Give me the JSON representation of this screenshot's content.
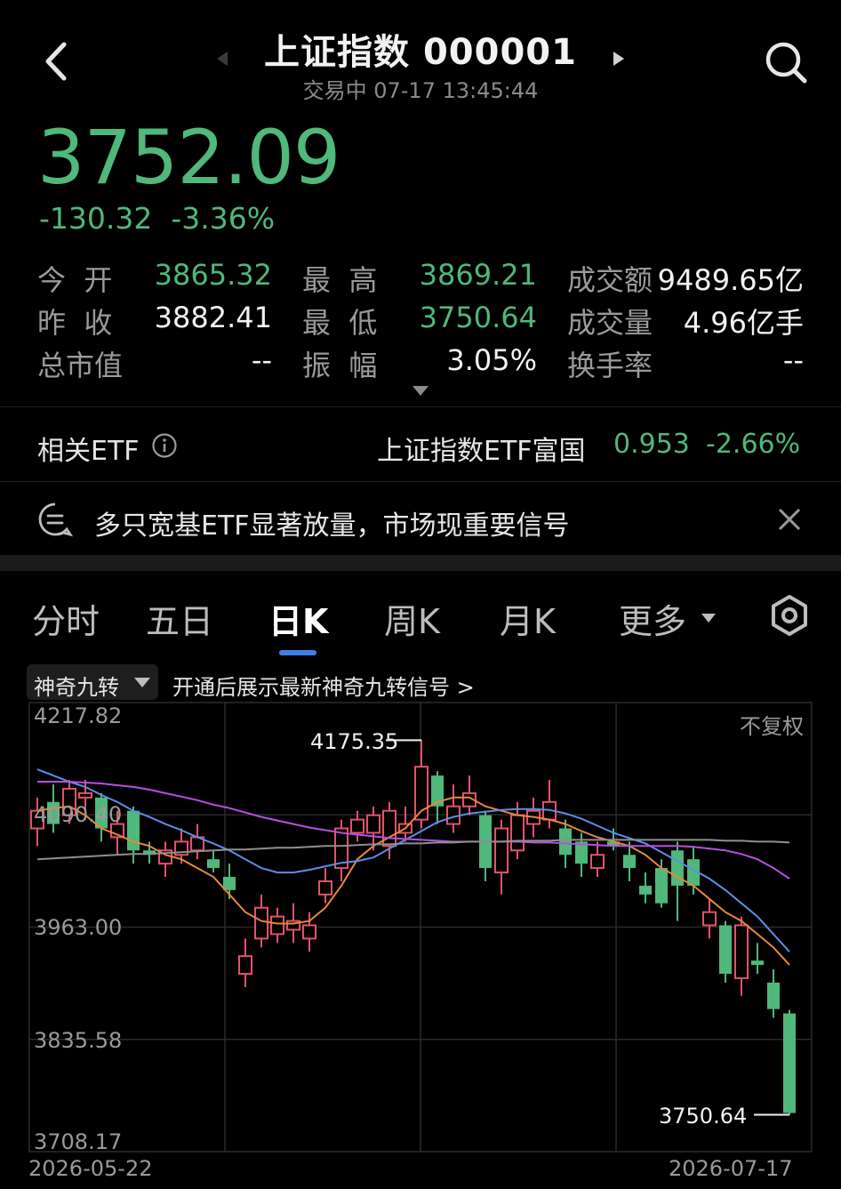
{
  "header": {
    "title": "上证指数 000001",
    "status": "交易中",
    "datetime": "07-17 13:45:44"
  },
  "quote": {
    "price": "3752.09",
    "change": "-130.32",
    "change_pct": "-3.36%"
  },
  "stats": [
    {
      "label": "今  开",
      "value": "3865.32",
      "color": "#4fb87a"
    },
    {
      "label": "最  高",
      "value": "3869.21",
      "color": "#4fb87a"
    },
    {
      "label": "成交额",
      "value": "9489.65亿",
      "color": "#f2f2f2"
    },
    {
      "label": "昨  收",
      "value": "3882.41",
      "color": "#f2f2f2"
    },
    {
      "label": "最  低",
      "value": "3750.64",
      "color": "#4fb87a"
    },
    {
      "label": "成交量",
      "value": "4.96亿手",
      "color": "#f2f2f2"
    },
    {
      "label": "总市值",
      "value": "--",
      "color": "#f2f2f2"
    },
    {
      "label": "振  幅",
      "value": "3.05%",
      "color": "#f2f2f2"
    },
    {
      "label": "换手率",
      "value": "--",
      "color": "#f2f2f2"
    }
  ],
  "etf": {
    "label": "相关ETF",
    "name": "上证指数ETF富国",
    "price": "0.953",
    "change_pct": "-2.66%"
  },
  "notice": {
    "text": "多只宽基ETF显著放量，市场现重要信号"
  },
  "tabs": [
    "分时",
    "五日",
    "日K",
    "周K",
    "月K",
    "更多"
  ],
  "active_tab": "日K",
  "indicator": {
    "chip_label": "神奇九转",
    "promo": "开通后展示最新神奇九转信号 >"
  },
  "chart_data": {
    "type": "candlestick",
    "adjust_label": "不复权",
    "y_ticks": [
      "4217.82",
      "4090.40",
      "3963.00",
      "3835.58",
      "3708.17"
    ],
    "ylim": [
      3708.17,
      4217.82
    ],
    "x_start": "2026-05-22",
    "x_end": "2026-07-17",
    "max_label": "4175.35",
    "min_label": "3750.64",
    "up_color": "#e0536a",
    "down_color": "#4fb87a",
    "candles": [
      {
        "o": 4075,
        "c": 4095,
        "h": 4110,
        "l": 4055
      },
      {
        "o": 4105,
        "c": 4080,
        "h": 4125,
        "l": 4070
      },
      {
        "o": 4090,
        "c": 4120,
        "h": 4130,
        "l": 4080
      },
      {
        "o": 4110,
        "c": 4115,
        "h": 4130,
        "l": 4085
      },
      {
        "o": 4110,
        "c": 4075,
        "h": 4115,
        "l": 4060
      },
      {
        "o": 4065,
        "c": 4080,
        "h": 4095,
        "l": 4045
      },
      {
        "o": 4095,
        "c": 4050,
        "h": 4100,
        "l": 4035
      },
      {
        "o": 4050,
        "c": 4045,
        "h": 4060,
        "l": 4035
      },
      {
        "o": 4035,
        "c": 4050,
        "h": 4060,
        "l": 4020
      },
      {
        "o": 4045,
        "c": 4060,
        "h": 4075,
        "l": 4035
      },
      {
        "o": 4050,
        "c": 4065,
        "h": 4080,
        "l": 4040
      },
      {
        "o": 4040,
        "c": 4030,
        "h": 4050,
        "l": 4025
      },
      {
        "o": 4020,
        "c": 4005,
        "h": 4035,
        "l": 3995
      },
      {
        "o": 3910,
        "c": 3930,
        "h": 3950,
        "l": 3895
      },
      {
        "o": 3950,
        "c": 3985,
        "h": 4000,
        "l": 3940
      },
      {
        "o": 3955,
        "c": 3975,
        "h": 3985,
        "l": 3945
      },
      {
        "o": 3960,
        "c": 3970,
        "h": 3990,
        "l": 3945
      },
      {
        "o": 3950,
        "c": 3965,
        "h": 3980,
        "l": 3935
      },
      {
        "o": 4000,
        "c": 4015,
        "h": 4030,
        "l": 3990
      },
      {
        "o": 4030,
        "c": 4075,
        "h": 4085,
        "l": 4015
      },
      {
        "o": 4070,
        "c": 4085,
        "h": 4095,
        "l": 4060
      },
      {
        "o": 4070,
        "c": 4090,
        "h": 4100,
        "l": 4050
      },
      {
        "o": 4055,
        "c": 4095,
        "h": 4105,
        "l": 4040
      },
      {
        "o": 4070,
        "c": 4080,
        "h": 4100,
        "l": 4060
      },
      {
        "o": 4085,
        "c": 4145,
        "h": 4175,
        "l": 4075
      },
      {
        "o": 4135,
        "c": 4100,
        "h": 4140,
        "l": 4080
      },
      {
        "o": 4080,
        "c": 4100,
        "h": 4125,
        "l": 4070
      },
      {
        "o": 4100,
        "c": 4115,
        "h": 4135,
        "l": 4090
      },
      {
        "o": 4090,
        "c": 4030,
        "h": 4095,
        "l": 4015
      },
      {
        "o": 4025,
        "c": 4075,
        "h": 4085,
        "l": 4000
      },
      {
        "o": 4050,
        "c": 4090,
        "h": 4105,
        "l": 4040
      },
      {
        "o": 4080,
        "c": 4095,
        "h": 4110,
        "l": 4065
      },
      {
        "o": 4085,
        "c": 4105,
        "h": 4130,
        "l": 4075
      },
      {
        "o": 4075,
        "c": 4045,
        "h": 4085,
        "l": 4030
      },
      {
        "o": 4060,
        "c": 4035,
        "h": 4070,
        "l": 4020
      },
      {
        "o": 4030,
        "c": 4045,
        "h": 4060,
        "l": 4020
      },
      {
        "o": 4060,
        "c": 4055,
        "h": 4075,
        "l": 4050
      },
      {
        "o": 4045,
        "c": 4030,
        "h": 4060,
        "l": 4015
      },
      {
        "o": 4010,
        "c": 4000,
        "h": 4025,
        "l": 3990
      },
      {
        "o": 4030,
        "c": 3990,
        "h": 4040,
        "l": 3985
      },
      {
        "o": 4050,
        "c": 4010,
        "h": 4060,
        "l": 3970
      },
      {
        "o": 4040,
        "c": 4010,
        "h": 4055,
        "l": 4000
      },
      {
        "o": 3965,
        "c": 3980,
        "h": 3995,
        "l": 3950
      },
      {
        "o": 3965,
        "c": 3910,
        "h": 3970,
        "l": 3900
      },
      {
        "o": 3905,
        "c": 3965,
        "h": 3975,
        "l": 3885
      },
      {
        "o": 3925,
        "c": 3920,
        "h": 3945,
        "l": 3910
      },
      {
        "o": 3900,
        "c": 3870,
        "h": 3915,
        "l": 3860
      },
      {
        "o": 3865,
        "c": 3752,
        "h": 3869,
        "l": 3750
      }
    ],
    "series": [
      {
        "name": "",
        "color": "#e8873c",
        "values": [
          4095,
          4098,
          4100,
          4090,
          4075,
          4068,
          4060,
          4055,
          4045,
          4040,
          4030,
          4020,
          4000,
          3980,
          3970,
          3967,
          3967,
          3970,
          3985,
          4010,
          4040,
          4055,
          4065,
          4075,
          4095,
          4105,
          4110,
          4110,
          4100,
          4095,
          4090,
          4088,
          4085,
          4080,
          4072,
          4065,
          4060,
          4055,
          4045,
          4030,
          4020,
          4010,
          3995,
          3980,
          3970,
          3955,
          3940,
          3920
        ]
      },
      {
        "name": "",
        "color": "#5b8ee8",
        "values": [
          4142,
          4135,
          4128,
          4122,
          4113,
          4105,
          4095,
          4088,
          4080,
          4073,
          4065,
          4058,
          4050,
          4040,
          4030,
          4025,
          4025,
          4028,
          4032,
          4036,
          4038,
          4042,
          4052,
          4062,
          4072,
          4082,
          4088,
          4092,
          4094,
          4096,
          4097,
          4097,
          4096,
          4092,
          4086,
          4078,
          4070,
          4064,
          4058,
          4048,
          4038,
          4028,
          4018,
          4005,
          3990,
          3975,
          3955,
          3935
        ]
      },
      {
        "name": "",
        "color": "#b84fe0",
        "values": [
          4128,
          4128,
          4128,
          4127,
          4126,
          4124,
          4122,
          4119,
          4115,
          4111,
          4107,
          4102,
          4098,
          4093,
          4088,
          4084,
          4080,
          4076,
          4073,
          4070,
          4068,
          4066,
          4064,
          4063,
          4062,
          4061,
          4060,
          4060,
          4060,
          4060,
          4060,
          4059,
          4059,
          4058,
          4057,
          4056,
          4055,
          4055,
          4055,
          4055,
          4055,
          4054,
          4052,
          4050,
          4046,
          4040,
          4030,
          4018
        ]
      },
      {
        "name": "",
        "color": "#8f8f8f",
        "values": [
          4040,
          4041,
          4042,
          4043,
          4044,
          4045,
          4046,
          4046,
          4047,
          4048,
          4049,
          4050,
          4051,
          4051,
          4052,
          4053,
          4053,
          4054,
          4055,
          4055,
          4056,
          4057,
          4057,
          4058,
          4058,
          4059,
          4059,
          4060,
          4060,
          4060,
          4061,
          4061,
          4061,
          4062,
          4062,
          4062,
          4062,
          4062,
          4062,
          4062,
          4062,
          4062,
          4062,
          4061,
          4061,
          4060,
          4060,
          4059
        ]
      }
    ]
  }
}
